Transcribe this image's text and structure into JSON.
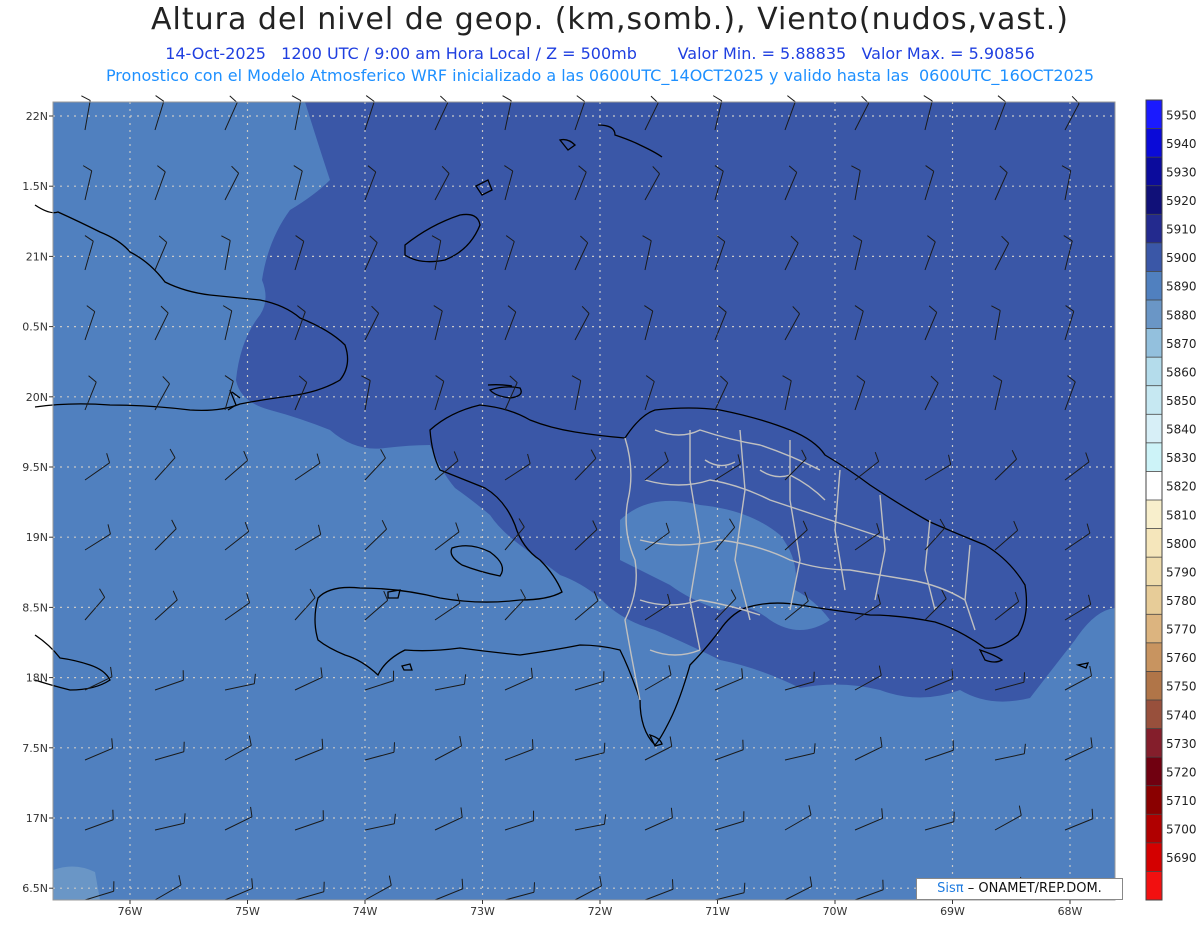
{
  "header": {
    "title": "Altura del nivel de geop. (km,somb.), Viento(nudos,vast.)",
    "line2_left": "14-Oct-2025   1200 UTC / 9:00 am Hora Local / Z = 500mb",
    "line2_right": "Valor Min. = 5.88835   Valor Max. = 5.90856",
    "line3": "Pronostico con el Modelo Atmosferico WRF inicializado a las 0600UTC_14OCT2025 y valido hasta las  0600UTC_16OCT2025"
  },
  "map": {
    "lat_labels": [
      "22N",
      "1.5N",
      "21N",
      "0.5N",
      "20N",
      "9.5N",
      "19N",
      "8.5N",
      "18N",
      "7.5N",
      "17N",
      "6.5N"
    ],
    "lon_labels": [
      "76W",
      "75W",
      "74W",
      "73W",
      "72W",
      "71W",
      "70W",
      "69W",
      "68W"
    ],
    "colors": {
      "fill_5890": "#5080bf",
      "fill_5900": "#3a57a7",
      "fill_5880_patch": "#6a96c6",
      "coast": "#000000",
      "borders": "#bdbdbd",
      "grid": "#c8c8c8"
    }
  },
  "colorbar": {
    "levels": [
      "5950",
      "5940",
      "5930",
      "5920",
      "5910",
      "5900",
      "5890",
      "5880",
      "5870",
      "5860",
      "5850",
      "5840",
      "5830",
      "5820",
      "5810",
      "5800",
      "5790",
      "5780",
      "5770",
      "5760",
      "5750",
      "5740",
      "5730",
      "5720",
      "5710",
      "5700",
      "5690"
    ],
    "colors": [
      "#1a1aff",
      "#0a0ad8",
      "#0b0b9c",
      "#101078",
      "#232a8e",
      "#3a57a7",
      "#5080bf",
      "#6a96c6",
      "#93c0dd",
      "#b4dceb",
      "#c6e8f2",
      "#d7eff7",
      "#cdf3f8",
      "#ffffff",
      "#f8efcc",
      "#f5e6bb",
      "#efdcac",
      "#e7cc98",
      "#dcb47f",
      "#c89460",
      "#b07548",
      "#98503c",
      "#841e2b",
      "#700010",
      "#8a0000",
      "#b00000",
      "#d40000",
      "#f21010"
    ]
  },
  "credit": {
    "logo": "Sisπ",
    "text": "– ONAMET/REP.DOM."
  }
}
